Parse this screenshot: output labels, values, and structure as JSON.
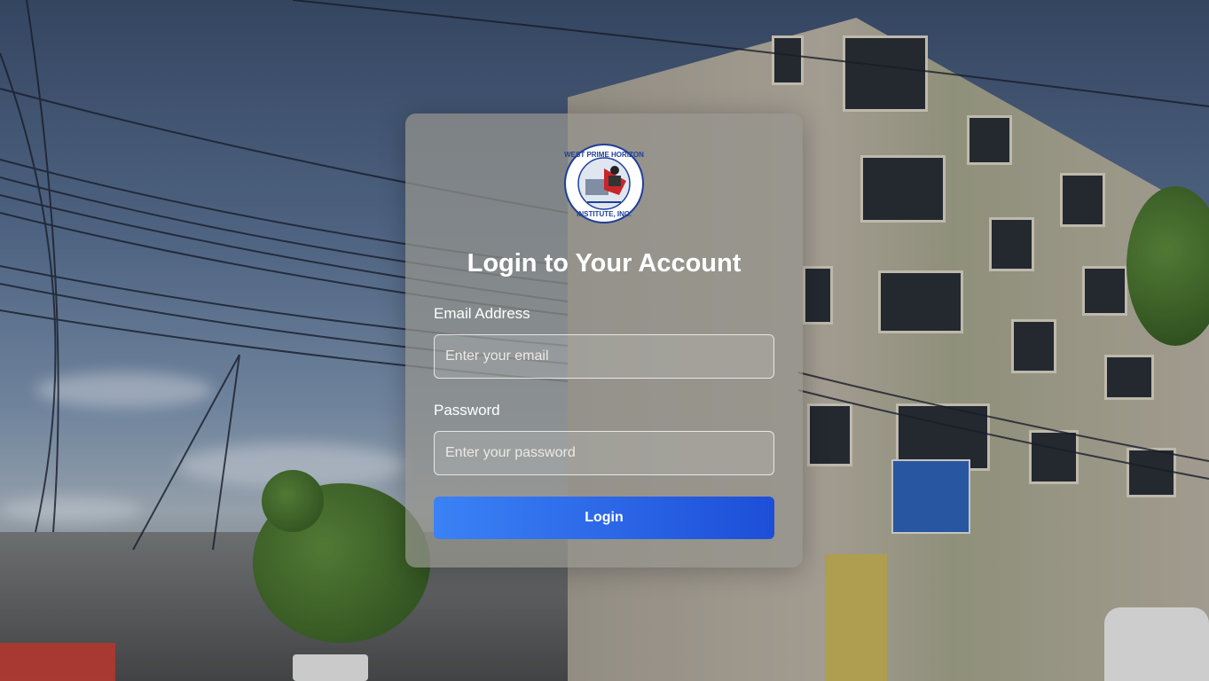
{
  "login": {
    "title": "Login to Your Account",
    "email_label": "Email Address",
    "email_placeholder": "Enter your email",
    "email_value": "",
    "password_label": "Password",
    "password_placeholder": "Enter your password",
    "password_value": "",
    "submit_label": "Login"
  },
  "logo": {
    "top_text": "WEST PRIME HORIZON",
    "bottom_text": "INSTITUTE, INC."
  },
  "colors": {
    "accent_start": "#3b82f6",
    "accent_end": "#1d4ed8"
  },
  "icons": [
    "school-logo"
  ]
}
